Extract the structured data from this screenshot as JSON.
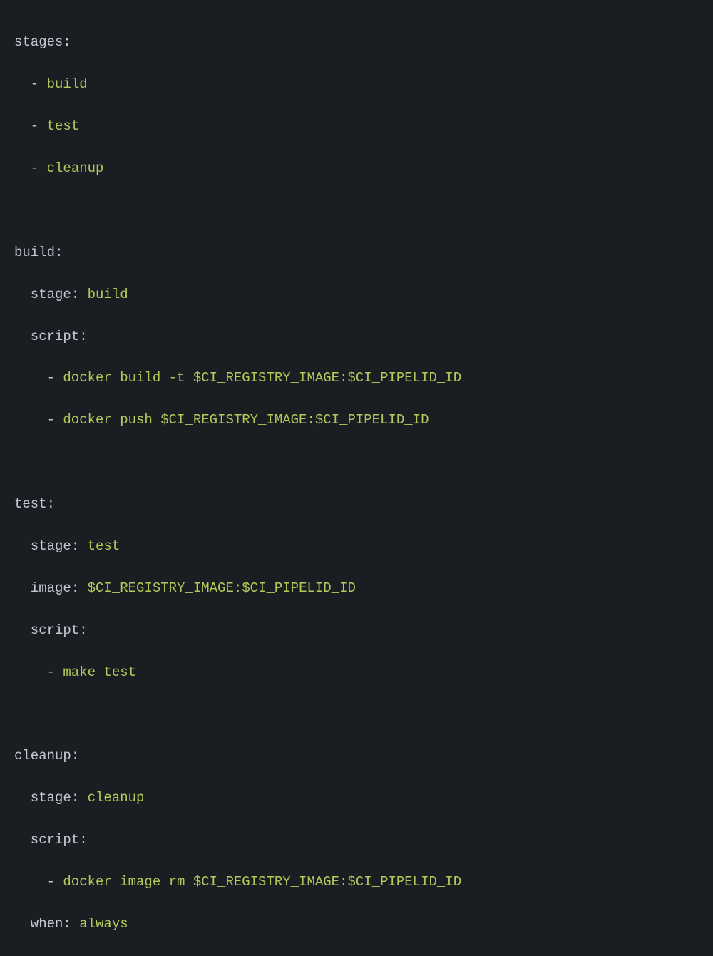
{
  "stages_key": "stages",
  "stages": [
    "build",
    "test",
    "cleanup"
  ],
  "jobs": {
    "build": {
      "name": "build",
      "stage_key": "stage",
      "stage_value": "build",
      "script_key": "script",
      "scripts": [
        "docker build -t $CI_REGISTRY_IMAGE:$CI_PIPELID_ID",
        "docker push $CI_REGISTRY_IMAGE:$CI_PIPELID_ID"
      ]
    },
    "test": {
      "name": "test",
      "stage_key": "stage",
      "stage_value": "test",
      "image_key": "image",
      "image_value": "$CI_REGISTRY_IMAGE:$CI_PIPELID_ID",
      "script_key": "script",
      "scripts": [
        "make test"
      ]
    },
    "cleanup": {
      "name": "cleanup",
      "stage_key": "stage",
      "stage_value": "cleanup",
      "script_key": "script",
      "scripts": [
        "docker image rm $CI_REGISTRY_IMAGE:$CI_PIPELID_ID"
      ],
      "when_key": "when",
      "when_value": "always"
    }
  }
}
